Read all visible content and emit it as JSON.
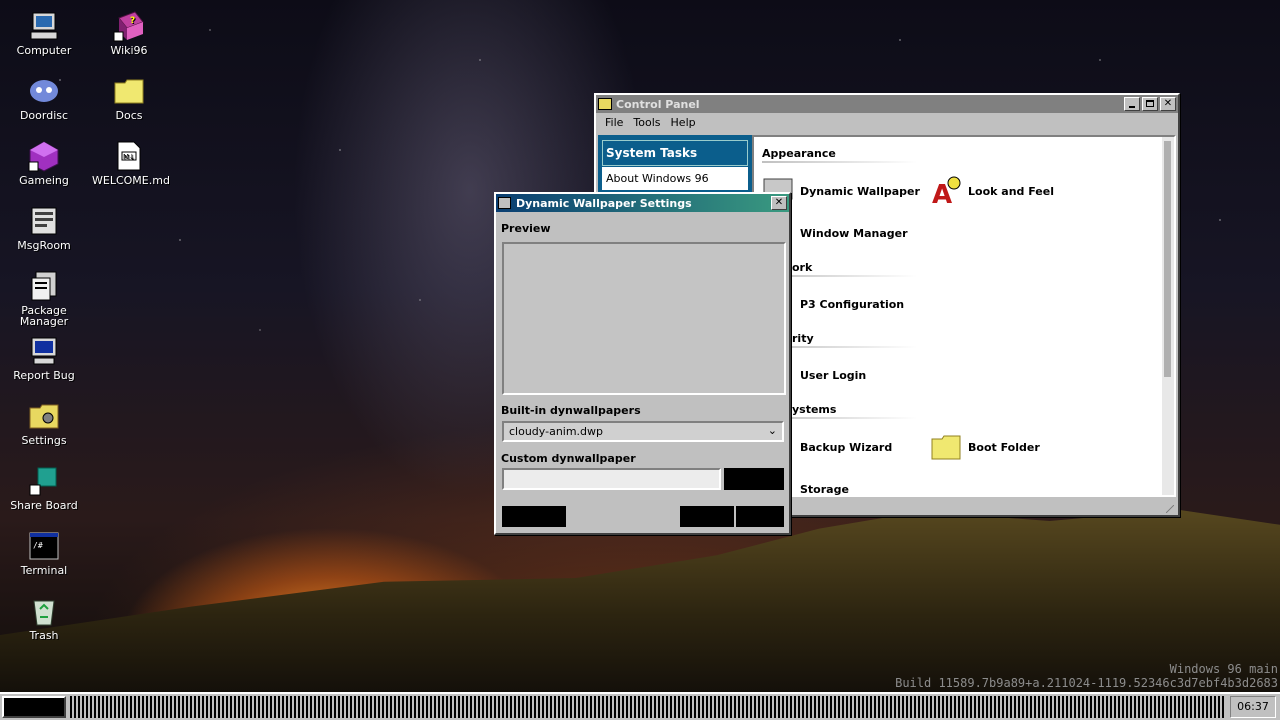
{
  "desktop": {
    "icons": [
      {
        "label": "Computer",
        "icon": "computer-icon"
      },
      {
        "label": "Doordisc",
        "icon": "chat-app-icon"
      },
      {
        "label": "Gameing",
        "icon": "game-cube-icon"
      },
      {
        "label": "MsgRoom",
        "icon": "message-room-icon"
      },
      {
        "label": "Package Manager",
        "icon": "package-manager-icon"
      },
      {
        "label": "Report Bug",
        "icon": "bug-report-icon"
      },
      {
        "label": "Settings",
        "icon": "settings-folder-icon"
      },
      {
        "label": "Share Board",
        "icon": "share-board-icon"
      },
      {
        "label": "Terminal",
        "icon": "terminal-icon"
      },
      {
        "label": "Trash",
        "icon": "recycle-bin-icon"
      },
      {
        "label": "Wiki96",
        "icon": "help-book-icon"
      },
      {
        "label": "Docs",
        "icon": "folder-icon"
      },
      {
        "label": "WELCOME.md",
        "icon": "markdown-file-icon"
      }
    ]
  },
  "control_panel": {
    "title": "Control Panel",
    "menu": [
      "File",
      "Tools",
      "Help"
    ],
    "sidebar": {
      "header": "System Tasks",
      "items": [
        "About Windows 96"
      ]
    },
    "sections": [
      {
        "heading": "Appearance",
        "items": [
          "Dynamic Wallpaper",
          "Look and Feel",
          "Window Manager"
        ]
      },
      {
        "heading": "ork",
        "items": [
          "P3 Configuration"
        ]
      },
      {
        "heading": "rity",
        "items": [
          "User Login"
        ]
      },
      {
        "heading": "ystems",
        "items": [
          "Backup Wizard",
          "Boot Folder",
          "Storage"
        ]
      }
    ]
  },
  "dialog": {
    "title": "Dynamic Wallpaper Settings",
    "preview_label": "Preview",
    "builtin_label": "Built-in dynwallpapers",
    "builtin_selected": "cloudy-anim.dwp",
    "custom_label": "Custom dynwallpaper",
    "custom_value": ""
  },
  "taskbar": {
    "clock": "06:37"
  },
  "build_info": {
    "line1": "Windows 96 main",
    "line2": "Build 11589.7b9a89+a.211024-1119.52346c3d7ebf4b3d2683"
  },
  "colors": {
    "dialog_title_gradient": [
      "#0a3e72",
      "#3a9a80"
    ],
    "panel_title": "#808080",
    "task_header": "#0b5e8c"
  }
}
